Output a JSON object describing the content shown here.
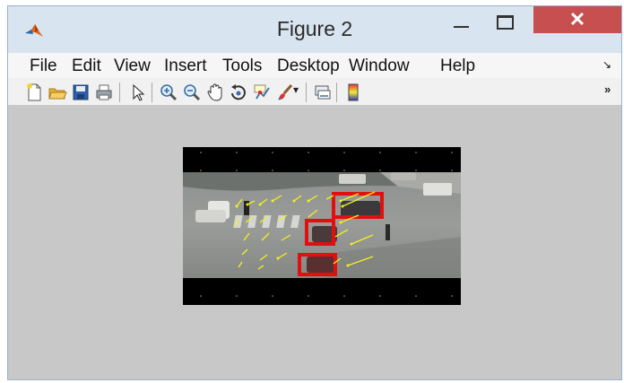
{
  "window": {
    "title": "Figure 2",
    "close_glyph": "✕"
  },
  "menu": {
    "items": [
      "File",
      "Edit",
      "View",
      "Insert",
      "Tools",
      "Desktop",
      "Window",
      "Help"
    ],
    "overflow_glyph": "↘"
  },
  "toolbar": {
    "buttons": [
      "new-figure",
      "open-file",
      "save-figure",
      "print-figure",
      "edit-plot",
      "zoom-in",
      "zoom-out",
      "pan",
      "rotate-3d",
      "data-cursor",
      "brush",
      "brush-dropdown",
      "link-plot",
      "insert-colorbar"
    ],
    "overflow_glyph": "»"
  },
  "colors": {
    "titlebar": "#d8e4f0",
    "close": "#c74f4f",
    "figure_bg": "#c8c8c8",
    "detection_box": "#e01010",
    "flow_arrow": "#f2f21a"
  }
}
